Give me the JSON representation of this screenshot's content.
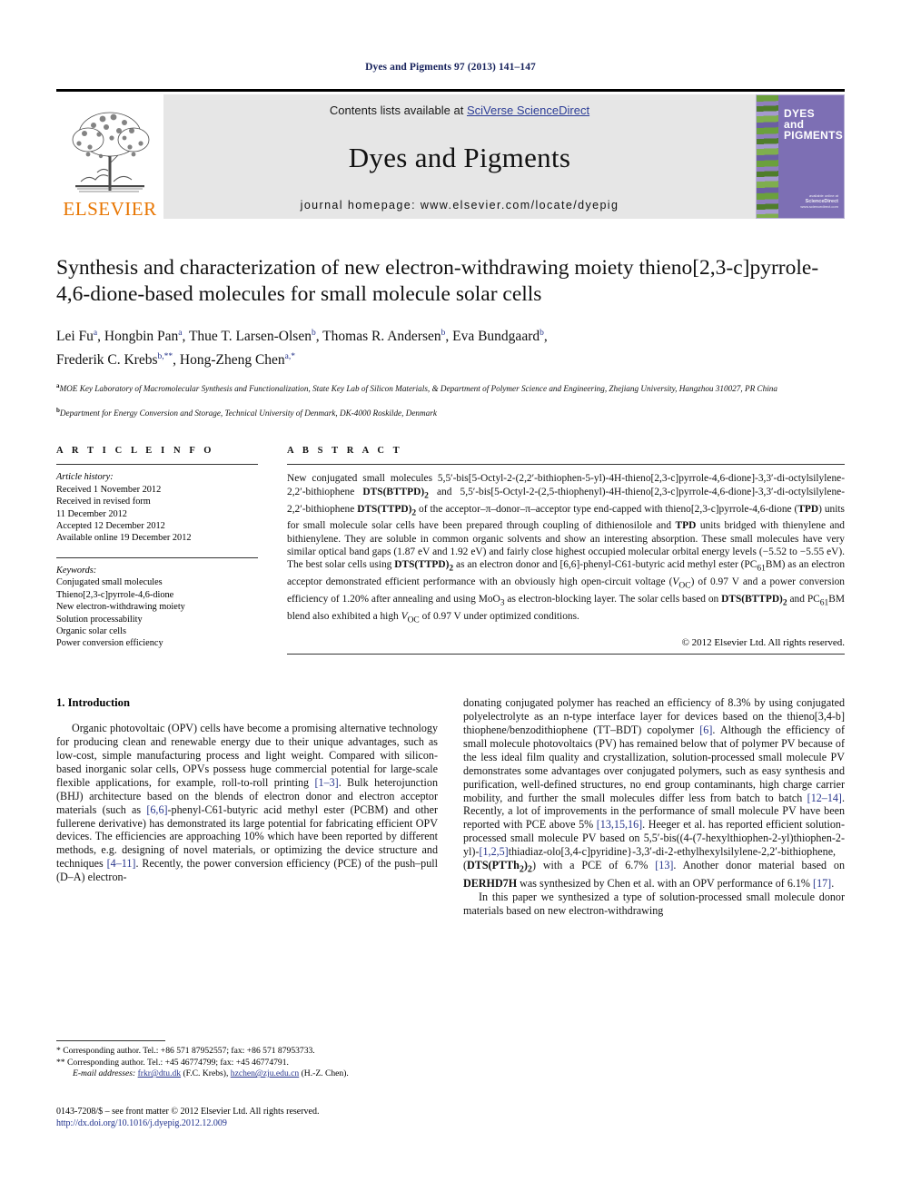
{
  "running_head": "Dyes and Pigments 97 (2013) 141–147",
  "masthead": {
    "publisher_name": "ELSEVIER",
    "contents_prefix": "Contents lists available at ",
    "contents_link": "SciVerse ScienceDirect",
    "journal_title": "Dyes and Pigments",
    "homepage": "journal homepage: www.elsevier.com/locate/dyepig",
    "cover": {
      "line1": "DYES",
      "line2": "and",
      "line3": "PIGMENTS",
      "foot_small": "available online at",
      "foot_sd": "ScienceDirect",
      "foot_url": "www.sciencedirect.com"
    }
  },
  "article": {
    "title": "Synthesis and characterization of new electron-withdrawing moiety thieno[2,3-c]pyrrole-4,6-dione-based molecules for small molecule solar cells",
    "authors_line1": "Lei Fu a, Hongbin Pan a, Thue T. Larsen-Olsen b, Thomas R. Andersen b, Eva Bundgaard b,",
    "authors_line2": "Frederik C. Krebs b,**, Hong-Zheng Chen a,*",
    "affiliation_a": "MOE Key Laboratory of Macromolecular Synthesis and Functionalization, State Key Lab of Silicon Materials, & Department of Polymer Science and Engineering, Zhejiang University, Hangzhou 310027, PR China",
    "affiliation_b": "Department for Energy Conversion and Storage, Technical University of Denmark, DK-4000 Roskilde, Denmark"
  },
  "article_info": {
    "heading": "A R T I C L E   I N F O",
    "history_heading": "Article history:",
    "history": [
      "Received 1 November 2012",
      "Received in revised form",
      "11 December 2012",
      "Accepted 12 December 2012",
      "Available online 19 December 2012"
    ],
    "keywords_heading": "Keywords:",
    "keywords": [
      "Conjugated small molecules",
      "Thieno[2,3-c]pyrrole-4,6-dione",
      "New electron-withdrawing moiety",
      "Solution processability",
      "Organic solar cells",
      "Power conversion efficiency"
    ]
  },
  "abstract": {
    "heading": "A B S T R A C T",
    "text": "New conjugated small molecules 5,5′-bis[5-Octyl-2-(2,2′-bithiophen-5-yl)-4H-thieno[2,3-c]pyrrole-4,6-dione]-3,3′-di-octylsilylene-2,2′-bithiophene DTS(BTTPD)2 and 5,5′-bis[5-Octyl-2-(2,5-thiophenyl)-4H-thieno[2,3-c]pyrrole-4,6-dione]-3,3′-di-octylsilylene-2,2′-bithiophene DTS(TTPD)2 of the acceptor–π–donor–π–acceptor type end-capped with thieno[2,3-c]pyrrole-4,6-dione (TPD) units for small molecule solar cells have been prepared through coupling of dithienosilole and TPD units bridged with thienylene and bithienylene. They are soluble in common organic solvents and show an interesting absorption. These small molecules have very similar optical band gaps (1.87 eV and 1.92 eV) and fairly close highest occupied molecular orbital energy levels (−5.52 to −5.55 eV). The best solar cells using DTS(TTPD)2 as an electron donor and [6,6]-phenyl-C61-butyric acid methyl ester (PC61BM) as an electron acceptor demonstrated efficient performance with an obviously high open-circuit voltage (VOC) of 0.97 V and a power conversion efficiency of 1.20% after annealing and using MoO3 as electron-blocking layer. The solar cells based on DTS(BTTPD)2 and PC61BM blend also exhibited a high VOC of 0.97 V under optimized conditions.",
    "copyright": "© 2012 Elsevier Ltd. All rights reserved."
  },
  "introduction": {
    "heading": "1. Introduction",
    "left_paragraph": "Organic photovoltaic (OPV) cells have become a promising alternative technology for producing clean and renewable energy due to their unique advantages, such as low-cost, simple manufacturing process and light weight. Compared with silicon-based inorganic solar cells, OPVs possess huge commercial potential for large-scale flexible applications, for example, roll-to-roll printing [1–3]. Bulk heterojunction (BHJ) architecture based on the blends of electron donor and electron acceptor materials (such as [6,6]-phenyl-C61-butyric acid methyl ester (PCBM) and other fullerene derivative) has demonstrated its large potential for fabricating efficient OPV devices. The efficiencies are approaching 10% which have been reported by different methods, e.g. designing of novel materials, or optimizing the device structure and techniques [4–11]. Recently, the power conversion efficiency (PCE) of the push–pull (D–A) electron-",
    "right_paragraph_1": "donating conjugated polymer has reached an efficiency of 8.3% by using conjugated polyelectrolyte as an n-type interface layer for devices based on the thieno[3,4-b] thiophene/benzodithiophene (TT–BDT) copolymer [6]. Although the efficiency of small molecule photovoltaics (PV) has remained below that of polymer PV because of the less ideal film quality and crystallization, solution-processed small molecule PV demonstrates some advantages over conjugated polymers, such as easy synthesis and purification, well-defined structures, no end group contaminants, high charge carrier mobility, and further the small molecules differ less from batch to batch [12–14]. Recently, a lot of improvements in the performance of small molecule PV have been reported with PCE above 5% [13,15,16]. Heeger et al. has reported efficient solution-processed small molecule PV based on 5,5′-bis((4-(7-hexylthiophen-2-yl)thiophen-2-yl)-[1,2,5]thiadiaz-olo[3,4-c]pyridine}-3,3′-di-2-ethylhexylsilylene-2,2′-bithiophene, (DTS(PTTh2)2) with a PCE of 6.7% [13]. Another donor material based on DERHD7H was synthesized by Chen et al. with an OPV performance of 6.1% [17].",
    "right_paragraph_2": "In this paper we synthesized a type of solution-processed small molecule donor materials based on new electron-withdrawing"
  },
  "footnotes": {
    "star": "* Corresponding author. Tel.: +86 571 87952557; fax: +86 571 87953733.",
    "doublestar": "** Corresponding author. Tel.: +45 46774799; fax: +45 46774791.",
    "email_label": "E-mail addresses:",
    "email_1": "frkr@dtu.dk",
    "email_1_owner": "(F.C. Krebs),",
    "email_2": "hzchen@zju.edu.cn",
    "email_2_owner": "(H.-Z. Chen)."
  },
  "footer": {
    "issn": "0143-7208/$ – see front matter © 2012 Elsevier Ltd. All rights reserved.",
    "doi": "http://dx.doi.org/10.1016/j.dyepig.2012.12.009"
  },
  "colors": {
    "link": "#26348b",
    "elsevier_orange": "#e87500",
    "cover_purple": "#7d6fb4"
  }
}
